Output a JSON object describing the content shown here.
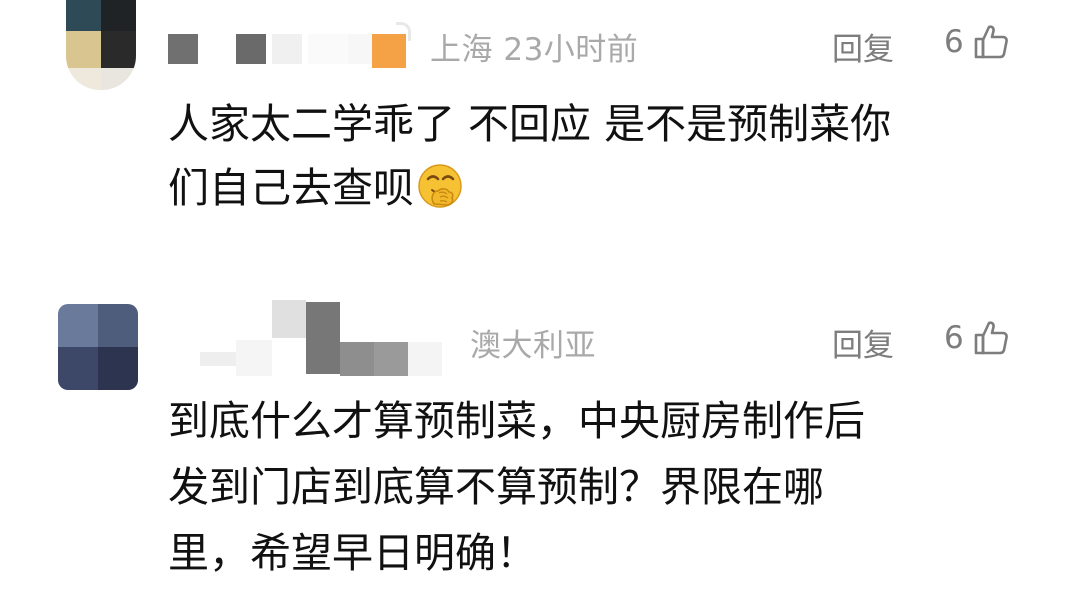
{
  "comments": [
    {
      "location_time": "上海 23小时前",
      "reply_label": "回复",
      "like_count": "6",
      "lines": [
        "人家太二学乖了 不回应 是不是预制菜你",
        "们自己去查呗"
      ],
      "emoji_icon": "face-with-hand-over-mouth-icon"
    },
    {
      "location_time": "澳大利亚",
      "reply_label": "回复",
      "like_count": "6",
      "lines": [
        "到底什么才算预制菜，中央厨房制作后",
        "发到门店到底算不算预制？界限在哪",
        "里，希望早日明确！"
      ]
    }
  ],
  "colors": {
    "meta_text": "#a9a9a9",
    "action_text": "#7d7d7d",
    "body_text": "#111111",
    "badge_orange": "#f5a247",
    "emoji_yellow": "#f6c233"
  }
}
